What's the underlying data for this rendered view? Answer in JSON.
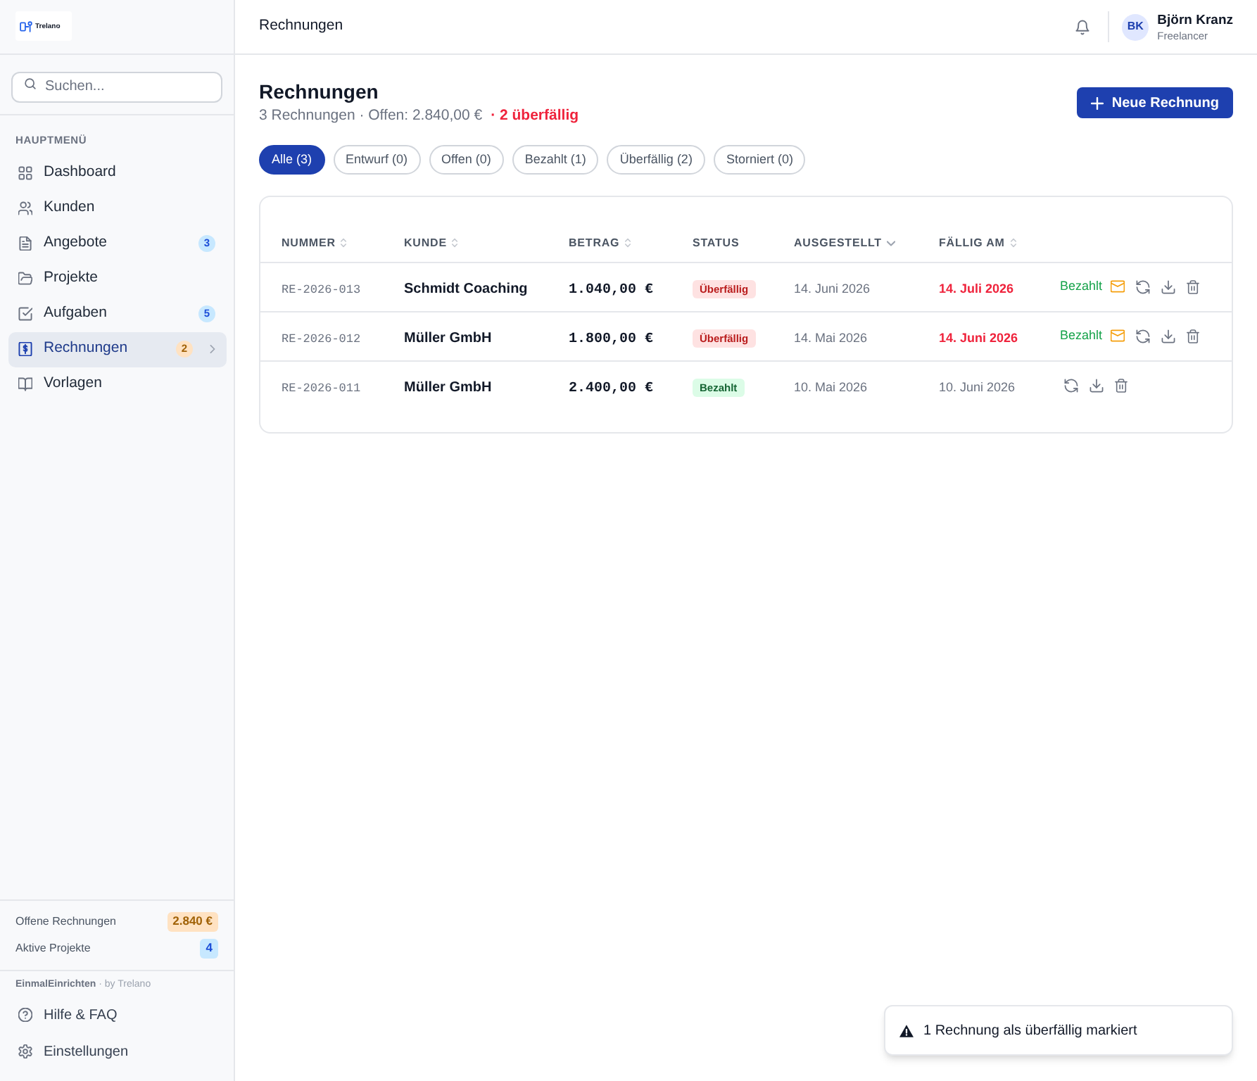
{
  "sidebar": {
    "logo": "Trelano",
    "search": {
      "placeholder": "Suchen..."
    },
    "section_label": "HAUPTMENÜ",
    "items": [
      {
        "label": "Dashboard",
        "selected": false
      },
      {
        "label": "Kunden",
        "selected": false
      },
      {
        "label": "Angebote",
        "selected": false,
        "badge": {
          "text": "3",
          "color": "#1d4ed8"
        }
      },
      {
        "label": "Projekte",
        "selected": false
      },
      {
        "label": "Aufgaben",
        "selected": false,
        "badge": {
          "text": "5",
          "color": "#1d4ed8"
        }
      },
      {
        "label": "Rechnungen",
        "selected": true,
        "badge": {
          "text": "2",
          "color": "#a16207"
        }
      },
      {
        "label": "Vorlagen",
        "selected": false
      }
    ],
    "stats": [
      {
        "label": "Offene Rechnungen",
        "value": "2.840 €",
        "color": "#a16207"
      },
      {
        "label": "Aktive Projekte",
        "value": "4",
        "color": "#1d4ed8"
      }
    ],
    "footer_note": "**EinmalEinrichten** · by Trelano",
    "footer_links": [
      {
        "label": "Hilfe & FAQ"
      },
      {
        "label": "Einstellungen"
      }
    ]
  },
  "header": {
    "title": "Rechnungen",
    "user": {
      "initials": "BK",
      "name": "Björn Kranz",
      "role": "Freelancer"
    }
  },
  "page": {
    "title": "Rechnungen",
    "summary": "3 Rechnungen · Offen: 2.840,00 €",
    "overdue_note": "· 2 überfällig",
    "new_button": "Neue Rechnung"
  },
  "filters": [
    {
      "label": "Alle (3)",
      "selected": true
    },
    {
      "label": "Entwurf (0)",
      "selected": false
    },
    {
      "label": "Offen (0)",
      "selected": false
    },
    {
      "label": "Bezahlt (1)",
      "selected": false
    },
    {
      "label": "Überfällig (2)",
      "selected": false
    },
    {
      "label": "Storniert (0)",
      "selected": false
    }
  ],
  "table": {
    "columns": [
      {
        "label": "NUMMER",
        "sortable": true,
        "sorted": false
      },
      {
        "label": "KUNDE",
        "sortable": true,
        "sorted": false
      },
      {
        "label": "BETRAG",
        "sortable": true,
        "sorted": false
      },
      {
        "label": "STATUS",
        "sortable": false,
        "sorted": false
      },
      {
        "label": "AUSGESTELLT",
        "sortable": true,
        "sorted": true
      },
      {
        "label": "FÄLLIG AM",
        "sortable": true,
        "sorted": false
      }
    ],
    "rows": [
      {
        "number": "RE-2026-013",
        "customer": "Schmidt Coaching",
        "amount": "1.040,00 €",
        "status": {
          "label": "Überfällig",
          "kind": "overdue"
        },
        "issued": "14. Juni 2026",
        "due": "14. Juli 2026",
        "overdue": true,
        "mark_paid": "Bezahlt",
        "reminder": true
      },
      {
        "number": "RE-2026-012",
        "customer": "Müller GmbH",
        "amount": "1.800,00 €",
        "status": {
          "label": "Überfällig",
          "kind": "overdue"
        },
        "issued": "14. Mai 2026",
        "due": "14. Juni 2026",
        "overdue": true,
        "mark_paid": "Bezahlt",
        "reminder": true
      },
      {
        "number": "RE-2026-011",
        "customer": "Müller GmbH",
        "amount": "2.400,00 €",
        "status": {
          "label": "Bezahlt",
          "kind": "paid"
        },
        "issued": "10. Mai 2026",
        "due": "10. Juni 2026",
        "overdue": false,
        "reminder": false
      }
    ]
  },
  "toast": {
    "kind": "warning",
    "message": "1 Rechnung als überfällig markiert"
  }
}
